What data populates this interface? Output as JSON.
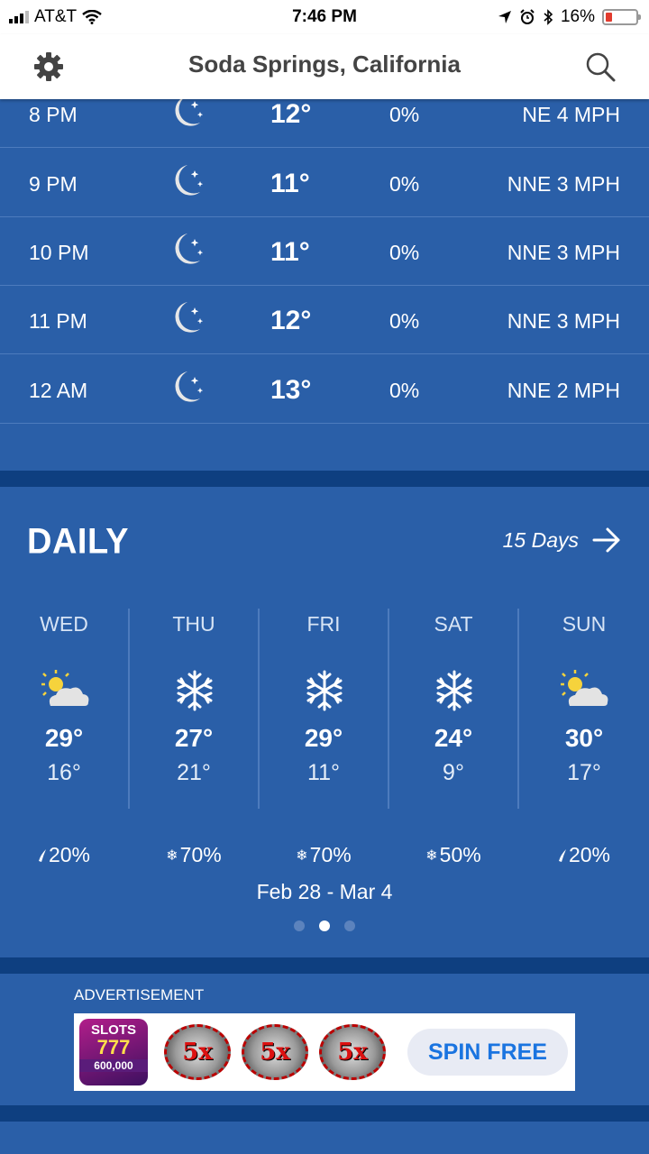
{
  "status_bar": {
    "carrier": "AT&T",
    "time": "7:46 PM",
    "battery": "16%"
  },
  "header": {
    "title": "Soda Springs, California",
    "settings_icon": "gear-icon",
    "search_icon": "search-icon"
  },
  "hourly": [
    {
      "time": "8 PM",
      "icon": "moon-stars-icon",
      "temp": "12°",
      "precip": "0%",
      "wind": "NE 4 MPH"
    },
    {
      "time": "9 PM",
      "icon": "moon-stars-icon",
      "temp": "11°",
      "precip": "0%",
      "wind": "NNE 3 MPH"
    },
    {
      "time": "10 PM",
      "icon": "moon-stars-icon",
      "temp": "11°",
      "precip": "0%",
      "wind": "NNE 3 MPH"
    },
    {
      "time": "11 PM",
      "icon": "moon-stars-icon",
      "temp": "12°",
      "precip": "0%",
      "wind": "NNE 3 MPH"
    },
    {
      "time": "12 AM",
      "icon": "moon-stars-icon",
      "temp": "13°",
      "precip": "0%",
      "wind": "NNE 2 MPH"
    }
  ],
  "daily": {
    "heading": "DAILY",
    "link_label": "15 Days",
    "days": [
      {
        "name": "WED",
        "icon": "partly-sunny-icon",
        "hi": "29°",
        "lo": "16°",
        "precip_icon": "raindrop-icon",
        "precip": "20%"
      },
      {
        "name": "THU",
        "icon": "snowflake-icon",
        "hi": "27°",
        "lo": "21°",
        "precip_icon": "snowflake-icon",
        "precip": "70%"
      },
      {
        "name": "FRI",
        "icon": "snowflake-icon",
        "hi": "29°",
        "lo": "11°",
        "precip_icon": "snowflake-icon",
        "precip": "70%"
      },
      {
        "name": "SAT",
        "icon": "snowflake-icon",
        "hi": "24°",
        "lo": "9°",
        "precip_icon": "snowflake-icon",
        "precip": "50%"
      },
      {
        "name": "SUN",
        "icon": "partly-sunny-icon",
        "hi": "30°",
        "lo": "17°",
        "precip_icon": "raindrop-icon",
        "precip": "20%"
      }
    ],
    "date_range": "Feb 28 - Mar 4",
    "page_dots": 3,
    "active_dot": 1
  },
  "ad": {
    "label": "ADVERTISEMENT",
    "logo_text": [
      "SLOTS",
      "777",
      "600,000"
    ],
    "chips": [
      "5x",
      "5x",
      "5x"
    ],
    "cta": "SPIN FREE"
  },
  "colors": {
    "background": "#2a5fa8",
    "divider": "#0e3f80",
    "header_bg": "#ffffff",
    "cta_text": "#1a74e0"
  }
}
